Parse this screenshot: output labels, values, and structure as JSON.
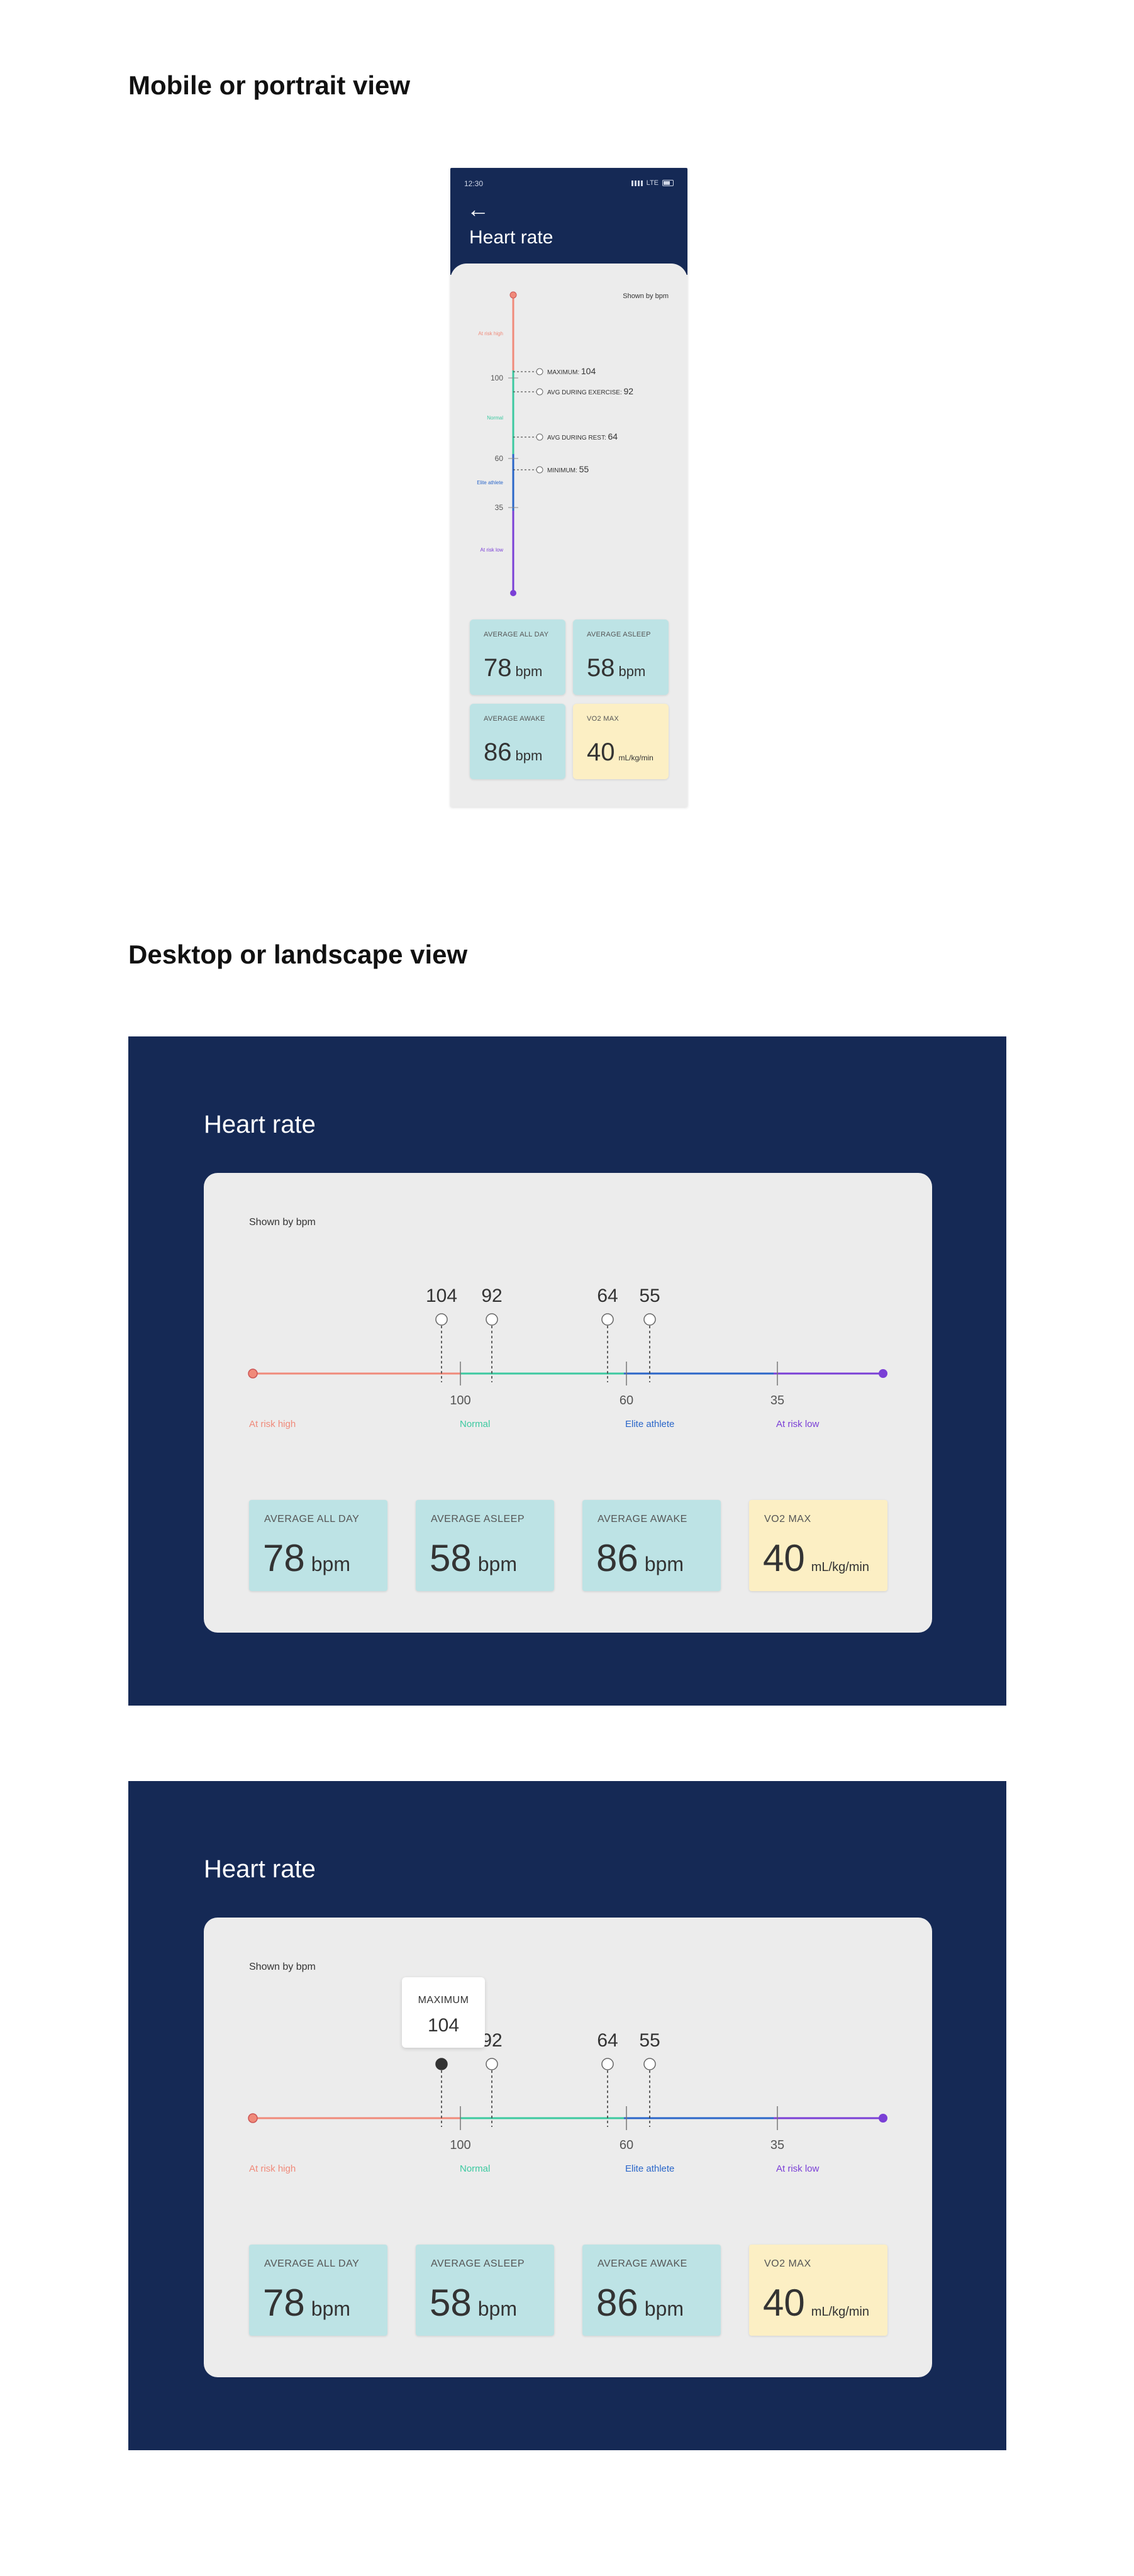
{
  "sections": {
    "mobile_title": "Mobile or portrait view",
    "desktop_title": "Desktop or landscape view"
  },
  "colors": {
    "navy": "#152955",
    "card": "#ececec",
    "stat_teal": "#bde3e5",
    "stat_yellow": "#fcefc4",
    "at_risk_high": "#f08a7a",
    "normal": "#3cc9a0",
    "elite": "#2a66c9",
    "at_risk_low": "#7a3fd6"
  },
  "mobile": {
    "status_time": "12:30",
    "status_network": "LTE",
    "title": "Heart rate",
    "shown_by": "Shown by bpm",
    "zones": {
      "high": "At risk high",
      "normal": "Normal",
      "elite": "Elite athlete",
      "low": "At risk low"
    },
    "ticks": [
      "100",
      "60",
      "35"
    ],
    "markers": [
      {
        "label": "MAXIMUM:",
        "value": "104"
      },
      {
        "label": "AVG DURING EXERCISE:",
        "value": "92"
      },
      {
        "label": "AVG DURING REST:",
        "value": "64"
      },
      {
        "label": "MINIMUM:",
        "value": "55"
      }
    ],
    "stats": [
      {
        "label": "AVERAGE ALL DAY",
        "value": "78",
        "unit": "bpm"
      },
      {
        "label": "AVERAGE ASLEEP",
        "value": "58",
        "unit": "bpm"
      },
      {
        "label": "AVERAGE AWAKE",
        "value": "86",
        "unit": "bpm"
      },
      {
        "label": "VO2 MAX",
        "value": "40",
        "unit": "mL/kg/min"
      }
    ]
  },
  "desktop": {
    "title": "Heart rate",
    "shown_by": "Shown by bpm",
    "markers": [
      "104",
      "92",
      "64",
      "55"
    ],
    "ticks": [
      "100",
      "60",
      "35"
    ],
    "zones": {
      "high": "At risk high",
      "normal": "Normal",
      "elite": "Elite athlete",
      "low": "At risk low"
    },
    "stats": [
      {
        "label": "AVERAGE ALL DAY",
        "value": "78",
        "unit": "bpm"
      },
      {
        "label": "AVERAGE ASLEEP",
        "value": "58",
        "unit": "bpm"
      },
      {
        "label": "AVERAGE AWAKE",
        "value": "86",
        "unit": "bpm"
      },
      {
        "label": "VO2 MAX",
        "value": "40",
        "unit": "mL/kg/min"
      }
    ]
  },
  "desktop_hover": {
    "title": "Heart rate",
    "shown_by": "Shown by bpm",
    "tooltip_label": "MAXIMUM",
    "tooltip_value": "104",
    "markers": [
      "92",
      "64",
      "55"
    ],
    "ticks": [
      "100",
      "60",
      "35"
    ],
    "zones": {
      "high": "At risk high",
      "normal": "Normal",
      "elite": "Elite athlete",
      "low": "At risk low"
    },
    "stats": [
      {
        "label": "AVERAGE ALL DAY",
        "value": "78",
        "unit": "bpm"
      },
      {
        "label": "AVERAGE ASLEEP",
        "value": "58",
        "unit": "bpm"
      },
      {
        "label": "AVERAGE AWAKE",
        "value": "86",
        "unit": "bpm"
      },
      {
        "label": "VO2 MAX",
        "value": "40",
        "unit": "mL/kg/min"
      }
    ]
  }
}
